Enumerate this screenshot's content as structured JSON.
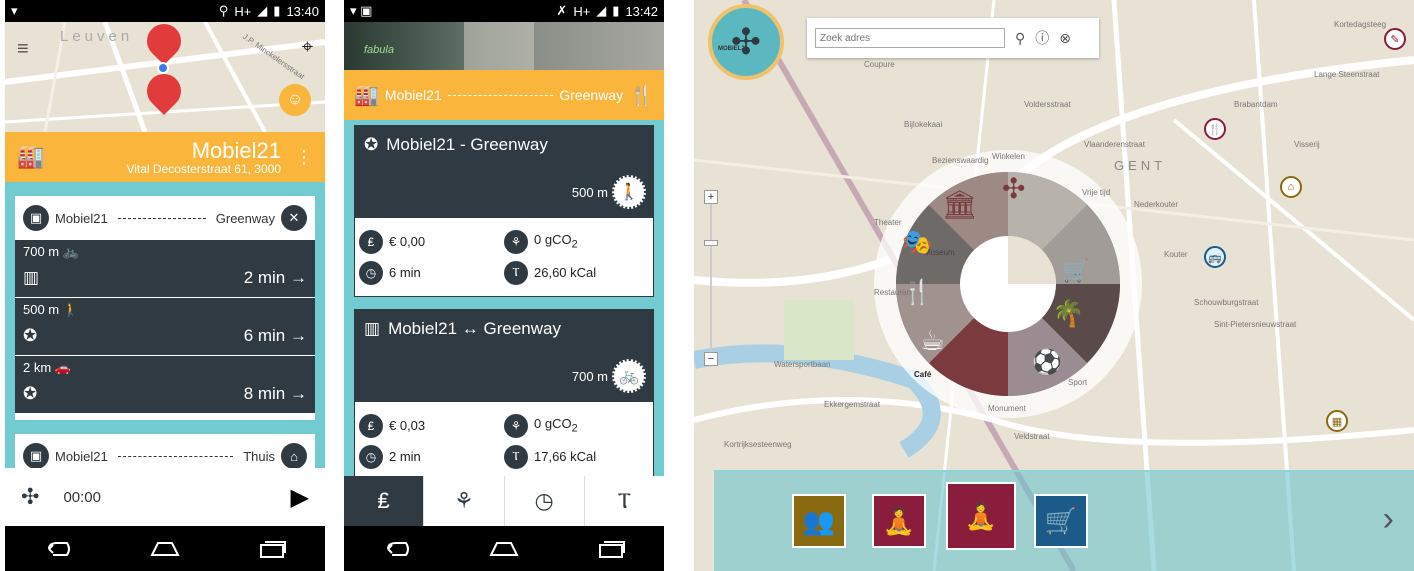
{
  "phone1": {
    "status": {
      "time": "13:40",
      "network": "H+"
    },
    "map": {
      "city_label": "Leuven",
      "street_label": "J.P. Minckelersstraat"
    },
    "header": {
      "title": "Mobiel21",
      "address": "Vital Decosterstraat 61, 3000"
    },
    "route1": {
      "from": "Mobiel21",
      "to": "Greenway",
      "options": [
        {
          "distance": "700 m",
          "mode_icon": "bike-icon",
          "duration": "2 min",
          "left_icon": "map-icon"
        },
        {
          "distance": "500 m",
          "mode_icon": "walk-icon",
          "duration": "6 min",
          "left_icon": "star-icon"
        },
        {
          "distance": "2 km",
          "mode_icon": "car-icon",
          "duration": "8 min",
          "left_icon": "star-icon"
        }
      ]
    },
    "route2": {
      "from": "Mobiel21",
      "to": "Thuis"
    },
    "player": {
      "time": "00:00"
    }
  },
  "phone2": {
    "status": {
      "time": "13:42",
      "network": "H+"
    },
    "photo_sign": "fabula",
    "routebar": {
      "from": "Mobiel21",
      "to": "Greenway"
    },
    "cards": [
      {
        "title": "Mobiel21 - Greenway",
        "title_icon": "star-icon",
        "distance": "500 m",
        "mode_icon": "walk-icon",
        "cost": "€ 0,00",
        "co2": "0 gCO",
        "co2_sub": "2",
        "time": "6 min",
        "kcal": "26,60 kCal"
      },
      {
        "title": "Mobiel21 ↔ Greenway",
        "title_icon": "map-icon",
        "distance": "700 m",
        "mode_icon": "bike-icon",
        "cost": "€ 0,03",
        "co2": "0 gCO",
        "co2_sub": "2",
        "time": "2 min",
        "kcal": "17,66 kCal"
      }
    ],
    "tabs": [
      "piggy-bank-icon",
      "co2-icon",
      "stopwatch-icon",
      "kcal-icon"
    ]
  },
  "web": {
    "logo_text": "MOBIEL21",
    "search_placeholder": "Zoek adres",
    "city_label": "GENT",
    "wheel_labels": [
      "Winkelen",
      "Vrije tijd",
      "Theater",
      "Bezienswaardig",
      "Museum",
      "Restaurant",
      "Café",
      "Monument",
      "Sport"
    ],
    "streets": [
      "Voldersstraat",
      "Nederkouter",
      "Kouter",
      "Brabantdam",
      "Sint-Pietersnieuwstraat",
      "Visserij",
      "Watersportbaan",
      "Schouwburgstraat",
      "Kortrijksesteenweg",
      "Ekkergemstraat",
      "Vlaanderenstraat",
      "Coupure",
      "Bijlokekaai",
      "Kortedagsteeg",
      "Lange Steenstraat",
      "Veldstraat"
    ],
    "accent": "#72cbd0",
    "orange": "#f9b53c",
    "dark": "#2f3a42"
  }
}
